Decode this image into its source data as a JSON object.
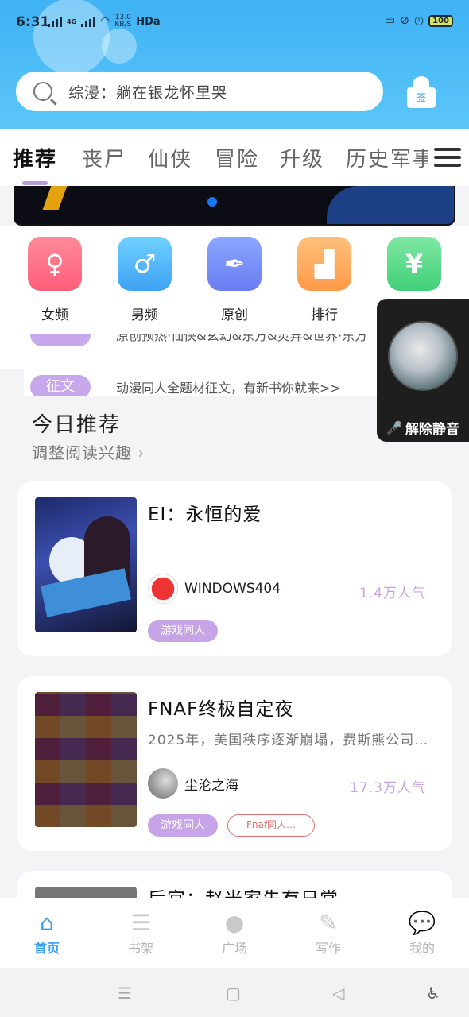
{
  "status_bar": {
    "time": "6:31",
    "net_label": "4G",
    "speed_value": "13.0",
    "speed_unit": "KB/S",
    "hd": "HDa",
    "battery": "100"
  },
  "search": {
    "placeholder": "综漫：躺在银龙怀里哭",
    "sign_label": "签"
  },
  "tabs": [
    "推荐",
    "丧尸",
    "仙侠",
    "冒险",
    "升级",
    "历史军事"
  ],
  "categories": [
    {
      "label": "女频",
      "icon": "female-icon",
      "color_from": "#ff8a99",
      "color_to": "#ff5e79"
    },
    {
      "label": "男频",
      "icon": "male-icon",
      "color_from": "#6fd0ff",
      "color_to": "#3fa2f4"
    },
    {
      "label": "原创",
      "icon": "pen-nib-icon",
      "color_from": "#8aa6ff",
      "color_to": "#6a7ef2"
    },
    {
      "label": "排行",
      "icon": "podium-icon",
      "color_from": "#ffc07a",
      "color_to": "#ff9a4a"
    },
    {
      "label": "",
      "icon": "yuan-icon",
      "color_from": "#7ee8a2",
      "color_to": "#41cf7a"
    }
  ],
  "notices": [
    {
      "tag": "",
      "text": "原创预热·仙侠&玄幻&东方&灵异&世界·东方"
    },
    {
      "tag": "征文",
      "text": "动漫同人全题材征文，有新书你就来>>"
    }
  ],
  "float_panel": {
    "unmute_label": "解除静音"
  },
  "recommend": {
    "title": "今日推荐",
    "subtitle": "调整阅读兴趣"
  },
  "books": [
    {
      "title": "EI：永恒的爱",
      "desc": "",
      "author": "WINDOWS404",
      "popularity": "1.4万人气",
      "tags": [
        "游戏同人"
      ]
    },
    {
      "title": "FNAF终极自定夜",
      "desc": "2025年，美国秩序逐渐崩塌，费斯熊公司…",
      "author": "尘沦之海",
      "popularity": "17.3万人气",
      "tags": [
        "游戏同人",
        "Fnaf同人…"
      ]
    },
    {
      "title": "后宫：赵米家先有日常",
      "desc": "",
      "author": "",
      "popularity": "",
      "tags": []
    }
  ],
  "bottom_nav": [
    {
      "label": "首页",
      "icon": "home-icon"
    },
    {
      "label": "书架",
      "icon": "bookshelf-icon"
    },
    {
      "label": "广场",
      "icon": "planet-icon"
    },
    {
      "label": "写作",
      "icon": "pencil-icon"
    },
    {
      "label": "我的",
      "icon": "chat-bubble-icon"
    }
  ],
  "colors": {
    "accent": "#3a9ff0",
    "tag_purple": "#c7a4e8",
    "header_blue": "#3fb2f5"
  }
}
